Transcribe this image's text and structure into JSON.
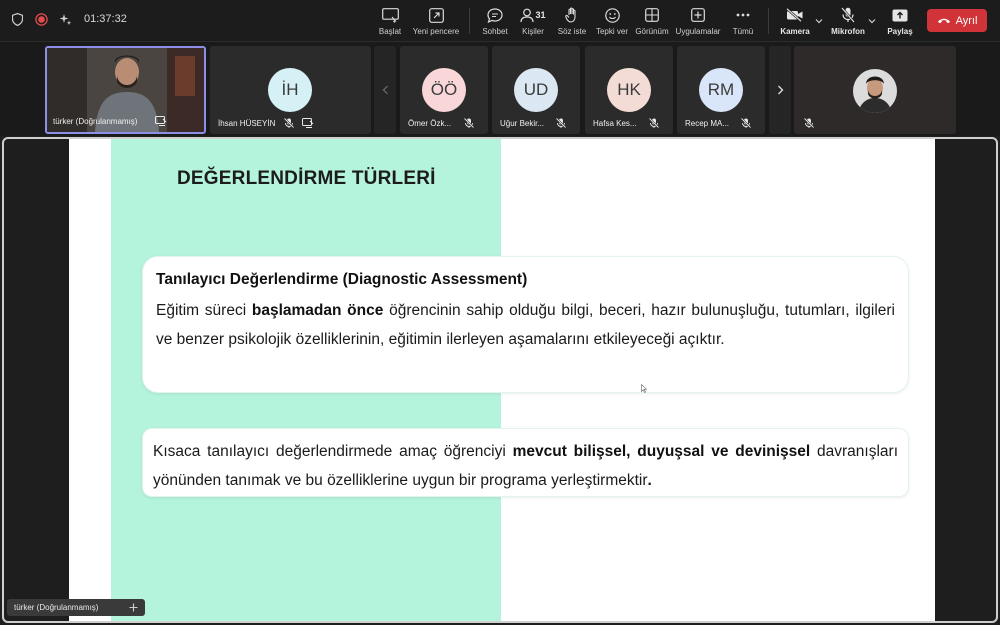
{
  "meeting": {
    "timer": "01:37:32",
    "toolbar": [
      {
        "key": "start",
        "label": "Başlat",
        "icon": "start-screen-icon",
        "bold": false
      },
      {
        "key": "new_window",
        "label": "Yeni pencere",
        "icon": "new-window-icon",
        "bold": false
      },
      {
        "key": "chat",
        "label": "Sohbet",
        "icon": "chat-icon",
        "bold": false
      },
      {
        "key": "people",
        "label": "Kişiler",
        "icon": "people-icon",
        "count": "31",
        "bold": false
      },
      {
        "key": "raise_hand",
        "label": "Söz iste",
        "icon": "raise-hand-icon",
        "bold": false
      },
      {
        "key": "react",
        "label": "Tepki ver",
        "icon": "react-icon",
        "bold": false
      },
      {
        "key": "view",
        "label": "Görünüm",
        "icon": "view-icon",
        "bold": false
      },
      {
        "key": "apps",
        "label": "Uygulamalar",
        "icon": "apps-icon",
        "bold": false
      },
      {
        "key": "more",
        "label": "Tümü",
        "icon": "more-icon",
        "bold": false
      },
      {
        "key": "camera",
        "label": "Kamera",
        "icon": "camera-off-icon",
        "bold": true
      },
      {
        "key": "mic",
        "label": "Mikrofon",
        "icon": "mic-off-icon",
        "bold": true
      },
      {
        "key": "share",
        "label": "Paylaş",
        "icon": "share-icon",
        "bold": true
      }
    ],
    "leave_label": "Ayrıl",
    "colors": {
      "leave": "#d13438",
      "active_tile_border": "#8d8fe6",
      "slide_green": "#b4f3dc"
    }
  },
  "participants": [
    {
      "name": "türker (Doğrulanmamış)",
      "type": "video",
      "active": true
    },
    {
      "name": "İhsan HÜSEYİN",
      "initials": "İH",
      "avatar_color": "#d6f1f6"
    },
    {
      "name": "Ömer Özk...",
      "initials": "ÖÖ",
      "avatar_color": "#f9d7d9"
    },
    {
      "name": "Uğur Bekir...",
      "initials": "UD",
      "avatar_color": "#dbe8f3"
    },
    {
      "name": "Hafsa Kes...",
      "initials": "HK",
      "avatar_color": "#f4dcd6"
    },
    {
      "name": "Recep MA...",
      "initials": "RM",
      "avatar_color": "#d9e5f8"
    },
    {
      "name": "",
      "type": "photo"
    }
  ],
  "slide": {
    "title": "DEĞERLENDİRME TÜRLERİ",
    "card1": {
      "heading": "Tanılayıcı Değerlendirme (Diagnostic Assessment)",
      "text_before": "Eğitim süreci ",
      "text_bold": "başlamadan önce",
      "text_after": " öğrencinin sahip olduğu bilgi, beceri, hazır bulunuşluğu, tutumları, ilgileri ve benzer psikolojik özelliklerinin, eğitimin ilerleyen aşamalarını etkileyeceği açıktır."
    },
    "card2": {
      "text_before": "Kısaca tanılayıcı değerlendirmede amaç öğrenciyi ",
      "text_bold": "mevcut bilişsel, duyuşsal ve devinişsel",
      "text_after": " davranışları yönünden tanımak ve bu özelliklerine uygun bir programa yerleştirmektir",
      "text_end_bold": "."
    }
  },
  "presenter_label": "türker (Doğrulanmamış)"
}
